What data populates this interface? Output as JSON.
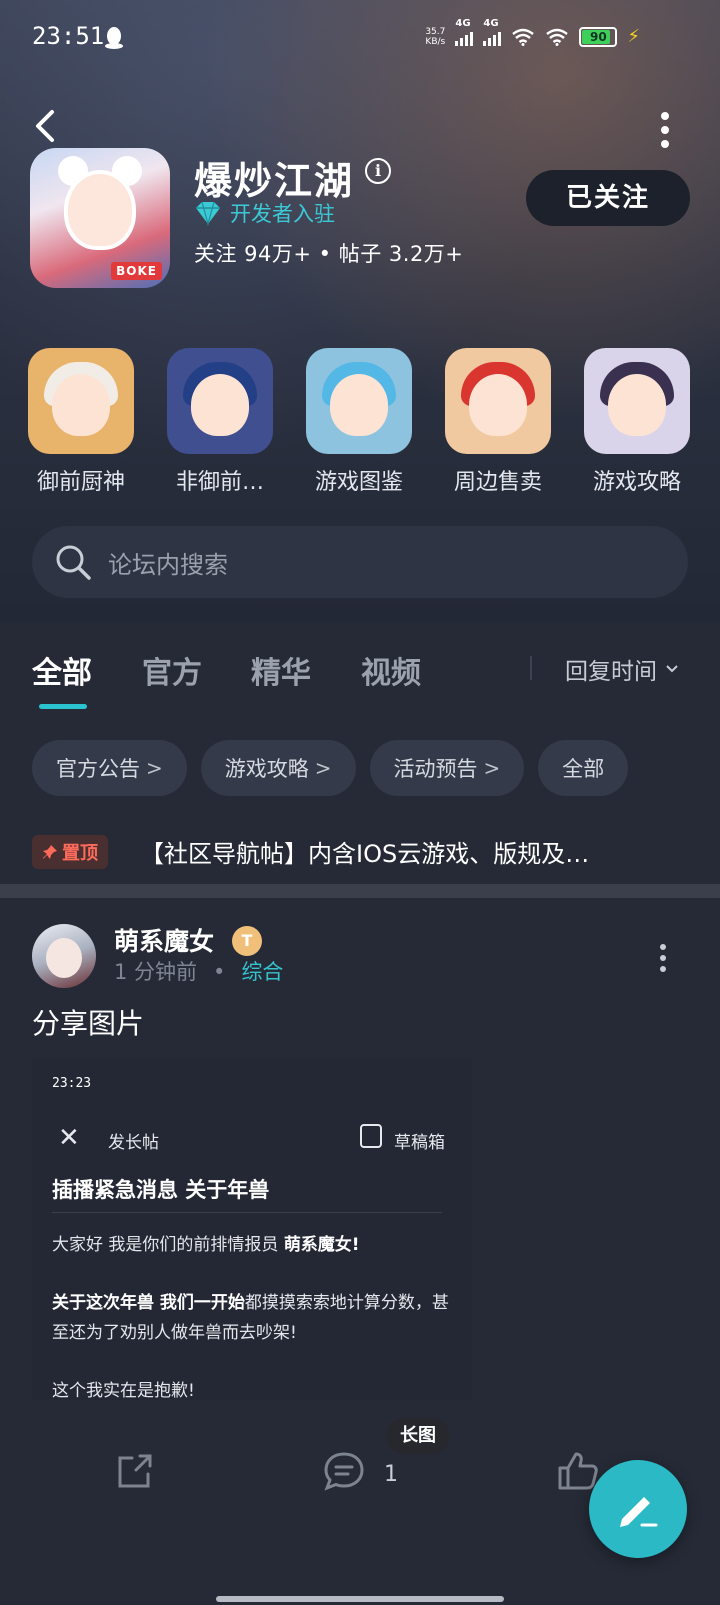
{
  "status_bar": {
    "time": "23:51",
    "net_speed_value": "35.7",
    "net_speed_unit": "KB/s",
    "sig1_tag": "4G",
    "sig2_tag": "4G",
    "battery": "90"
  },
  "forum": {
    "title": "爆炒江湖",
    "dev_badge": "开发者入驻",
    "stats": "关注 94万+  •  帖子 3.2万+",
    "follow_label": "已关注"
  },
  "entries": [
    {
      "label": "御前厨神",
      "bg": "#e8b36a",
      "hair": "#f1ede6"
    },
    {
      "label": "非御前…",
      "bg": "#3f4f8f",
      "hair": "#233f86"
    },
    {
      "label": "游戏图鉴",
      "bg": "#8ec3e0",
      "hair": "#53b8e6"
    },
    {
      "label": "周边售卖",
      "bg": "#f1c9a0",
      "hair": "#d8362f"
    },
    {
      "label": "游戏攻略",
      "bg": "#d9d4ea",
      "hair": "#3a3150"
    }
  ],
  "search": {
    "placeholder": "论坛内搜索"
  },
  "tabs": [
    {
      "label": "全部",
      "active": true
    },
    {
      "label": "官方"
    },
    {
      "label": "精华"
    },
    {
      "label": "视频"
    }
  ],
  "sort": {
    "label": "回复时间"
  },
  "chips": [
    {
      "label": "官方公告",
      "arrow": ">"
    },
    {
      "label": "游戏攻略",
      "arrow": ">"
    },
    {
      "label": "活动预告",
      "arrow": ">"
    },
    {
      "label": "全部",
      "arrow": ""
    }
  ],
  "pinned": {
    "badge": "置顶",
    "title": "【社区导航帖】内含IOS云游戏、版规及…"
  },
  "post": {
    "author": "萌系魔女",
    "level": "T",
    "time": "1 分钟前",
    "category": "综合",
    "text": "分享图片",
    "comment_count": "1",
    "long_image_badge": "长图",
    "screenshot": {
      "time": "23:23",
      "left_title": "发长帖",
      "draft": "草稿箱",
      "heading": "插播紧急消息 关于年兽",
      "p1_normal": "大家好 我是你们的前排情报员 ",
      "p1_bold": "萌系魔女!",
      "p2_bold": "关于这次年兽 我们一开始",
      "p2_normal": "都摸摸索索地计算分数，甚至还为了劝别人做年兽而去吵架!",
      "p3": "这个我实在是抱歉!"
    }
  },
  "colors": {
    "accent": "#2bc3cf",
    "background": "#252a36",
    "pin": "#ff6b5b"
  }
}
